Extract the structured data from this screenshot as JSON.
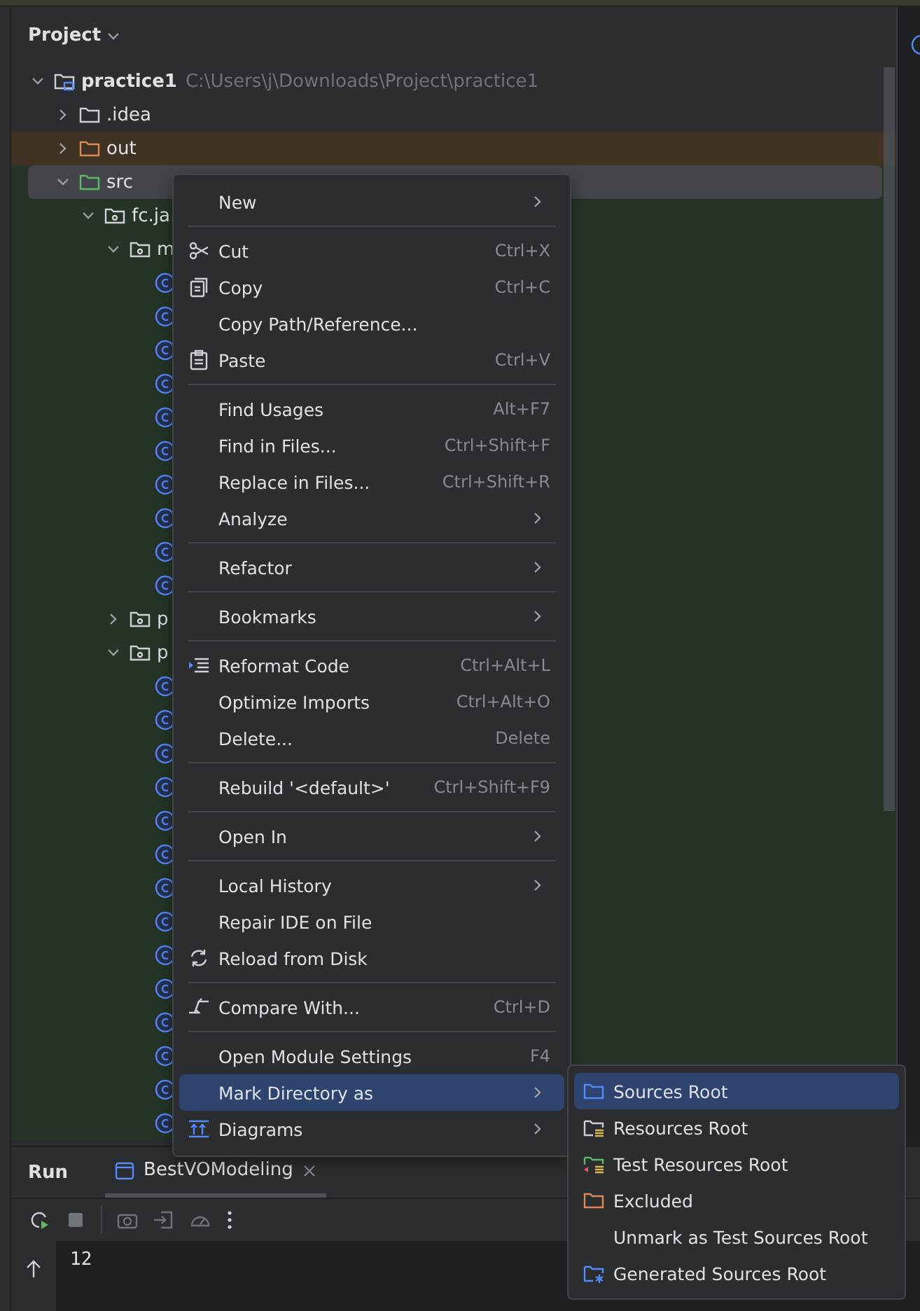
{
  "project_panel": {
    "title": "Project",
    "tree": [
      {
        "label": "practice1",
        "path": "C:\\Users\\j\\Downloads\\Project\\practice1",
        "kind": "module",
        "expanded": true,
        "selected": false,
        "children": [
          {
            "label": ".idea",
            "kind": "folder",
            "expanded": false,
            "selected": false
          },
          {
            "label": "out",
            "kind": "excluded",
            "expanded": false,
            "selected": false
          },
          {
            "label": "src",
            "kind": "source",
            "expanded": true,
            "selected": true,
            "children": [
              {
                "label": "fc.ja",
                "kind": "package",
                "expanded": true,
                "selected": false,
                "children": [
                  {
                    "label": "m",
                    "kind": "package",
                    "expanded": true,
                    "selected": false,
                    "children": [
                      {
                        "kind": "class"
                      },
                      {
                        "kind": "class"
                      },
                      {
                        "kind": "class"
                      },
                      {
                        "kind": "class"
                      },
                      {
                        "kind": "class"
                      },
                      {
                        "kind": "class"
                      },
                      {
                        "kind": "class"
                      },
                      {
                        "kind": "class"
                      },
                      {
                        "kind": "class"
                      },
                      {
                        "kind": "class"
                      }
                    ]
                  },
                  {
                    "label": "p",
                    "kind": "package",
                    "expanded": false,
                    "selected": false
                  },
                  {
                    "label": "p",
                    "kind": "package",
                    "expanded": true,
                    "selected": false,
                    "children": [
                      {
                        "kind": "class"
                      },
                      {
                        "kind": "class"
                      },
                      {
                        "kind": "class"
                      },
                      {
                        "kind": "class"
                      },
                      {
                        "kind": "class"
                      },
                      {
                        "kind": "class"
                      },
                      {
                        "kind": "class"
                      },
                      {
                        "kind": "class"
                      },
                      {
                        "kind": "class"
                      },
                      {
                        "kind": "class"
                      },
                      {
                        "kind": "class"
                      },
                      {
                        "kind": "class"
                      },
                      {
                        "kind": "class"
                      },
                      {
                        "kind": "class"
                      }
                    ]
                  }
                ]
              }
            ]
          }
        ]
      }
    ]
  },
  "context_menu": [
    {
      "kind": "item",
      "label": "New",
      "submenu": true,
      "selected": false
    },
    {
      "kind": "separator"
    },
    {
      "kind": "cut",
      "label": "Cut",
      "shortcut": "Ctrl+X",
      "selected": false
    },
    {
      "kind": "copy",
      "label": "Copy",
      "shortcut": "Ctrl+C",
      "selected": false
    },
    {
      "kind": "item",
      "label": "Copy Path/Reference...",
      "selected": false
    },
    {
      "kind": "paste",
      "label": "Paste",
      "shortcut": "Ctrl+V",
      "selected": false
    },
    {
      "kind": "separator"
    },
    {
      "kind": "item",
      "label": "Find Usages",
      "shortcut": "Alt+F7",
      "selected": false
    },
    {
      "kind": "item",
      "label": "Find in Files...",
      "shortcut": "Ctrl+Shift+F",
      "selected": false
    },
    {
      "kind": "item",
      "label": "Replace in Files...",
      "shortcut": "Ctrl+Shift+R",
      "selected": false
    },
    {
      "kind": "item",
      "label": "Analyze",
      "submenu": true,
      "selected": false
    },
    {
      "kind": "separator"
    },
    {
      "kind": "item",
      "label": "Refactor",
      "submenu": true,
      "selected": false
    },
    {
      "kind": "separator"
    },
    {
      "kind": "item",
      "label": "Bookmarks",
      "submenu": true,
      "selected": false
    },
    {
      "kind": "separator"
    },
    {
      "kind": "reformat",
      "label": "Reformat Code",
      "shortcut": "Ctrl+Alt+L",
      "selected": false
    },
    {
      "kind": "item",
      "label": "Optimize Imports",
      "shortcut": "Ctrl+Alt+O",
      "selected": false
    },
    {
      "kind": "item",
      "label": "Delete...",
      "shortcut": "Delete",
      "selected": false
    },
    {
      "kind": "separator"
    },
    {
      "kind": "item",
      "label": "Rebuild '<default>'",
      "shortcut": "Ctrl+Shift+F9",
      "selected": false
    },
    {
      "kind": "separator"
    },
    {
      "kind": "item",
      "label": "Open In",
      "submenu": true,
      "selected": false
    },
    {
      "kind": "separator"
    },
    {
      "kind": "item",
      "label": "Local History",
      "submenu": true,
      "selected": false
    },
    {
      "kind": "item",
      "label": "Repair IDE on File",
      "selected": false
    },
    {
      "kind": "reload",
      "label": "Reload from Disk",
      "selected": false
    },
    {
      "kind": "separator"
    },
    {
      "kind": "compare",
      "label": "Compare With...",
      "shortcut": "Ctrl+D",
      "selected": false
    },
    {
      "kind": "separator"
    },
    {
      "kind": "item",
      "label": "Open Module Settings",
      "shortcut": "F4",
      "selected": false
    },
    {
      "kind": "item",
      "label": "Mark Directory as",
      "submenu": true,
      "selected": true
    },
    {
      "kind": "diagrams",
      "label": "Diagrams",
      "submenu": true,
      "selected": false
    }
  ],
  "submenu": [
    {
      "kind": "sources",
      "label": "Sources Root",
      "selected": true
    },
    {
      "kind": "resources",
      "label": "Resources Root",
      "selected": false
    },
    {
      "kind": "test_resources",
      "label": "Test Resources Root",
      "selected": false
    },
    {
      "kind": "excluded",
      "label": "Excluded",
      "selected": false
    },
    {
      "kind": "plain",
      "label": "Unmark as Test Sources Root",
      "selected": false
    },
    {
      "kind": "generated",
      "label": "Generated Sources Root",
      "selected": false
    }
  ],
  "run_panel": {
    "title": "Run",
    "tabs": [
      {
        "label": "BestVOModeling",
        "selected": true
      }
    ],
    "console_lines": [
      "12"
    ]
  }
}
